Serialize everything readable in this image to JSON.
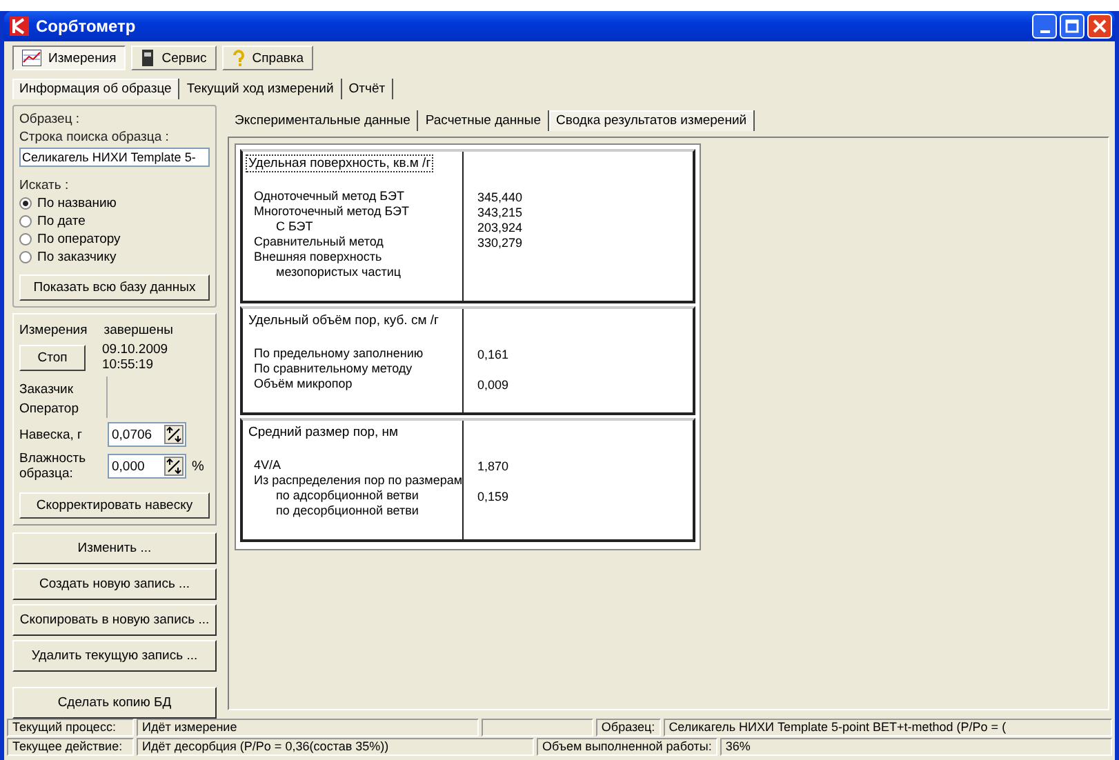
{
  "window": {
    "title": "Сорбтометр"
  },
  "menu": [
    {
      "label": "Измерения",
      "selected": true
    },
    {
      "label": "Сервис",
      "selected": false
    },
    {
      "label": "Справка",
      "selected": false
    }
  ],
  "tabs": [
    {
      "label": "Информация об образце",
      "selected": true
    },
    {
      "label": "Текущий ход измерений",
      "selected": false
    },
    {
      "label": "Отчёт",
      "selected": false
    }
  ],
  "sample": {
    "legend": "Образец :",
    "search_label": "Строка поиска образца :",
    "search_value": "Селикагель НИХИ Template 5-",
    "search_by_label": "Искать :",
    "radios": [
      {
        "label": "По названию",
        "selected": true
      },
      {
        "label": "По дате",
        "selected": false
      },
      {
        "label": "По оператору",
        "selected": false
      },
      {
        "label": "По заказчику",
        "selected": false
      }
    ],
    "show_all_button": "Показать всю базу данных"
  },
  "measurement": {
    "status_label": "Измерения",
    "status_value": "завершены",
    "stop_button": "Стоп",
    "date": "09.10.2009",
    "time": "10:55:19",
    "customer_label": "Заказчик",
    "operator_label": "Оператор",
    "weight_label": "Навеска, г",
    "weight_value": "0,0706",
    "moisture_label": "Влажность образца:",
    "moisture_value": "0,000",
    "moisture_unit": "%",
    "correct_button": "Скорректировать навеску"
  },
  "buttons": [
    "Изменить ...",
    "Создать новую запись ...",
    "Скопировать в новую запись ...",
    "Удалить текущую запись ...",
    "Сделать копию БД"
  ],
  "inner_tabs": [
    {
      "label": "Экспериментальные данные",
      "selected": false
    },
    {
      "label": "Расчетные данные",
      "selected": false
    },
    {
      "label": "Сводка результатов измерений",
      "selected": true
    }
  ],
  "sections": [
    {
      "title": "Удельная поверхность, кв.м /г",
      "focused": true,
      "rows": [
        {
          "label": "Одноточечный метод БЭТ",
          "value": "345,440"
        },
        {
          "label": "Многоточечный метод БЭТ",
          "value": "343,215",
          "children": [
            {
              "label": "С БЭТ",
              "value": "203,924"
            }
          ]
        },
        {
          "label": "Сравнительный метод",
          "value": "330,279"
        },
        {
          "label": "Внешняя поверхность",
          "children": [
            {
              "label": "мезопористых частиц"
            }
          ]
        }
      ]
    },
    {
      "title": "Удельный объём пор, куб. см /г",
      "focused": false,
      "rows": [
        {
          "label": "По предельному заполнению",
          "value": "0,161"
        },
        {
          "label": "По сравнительному методу"
        },
        {
          "label": "Объём микропор",
          "value": "0,009"
        }
      ]
    },
    {
      "title": "Средний размер пор, нм",
      "focused": false,
      "rows": [
        {
          "label": "4V/A",
          "value": "1,870"
        },
        {
          "label": "Из распределения пор по размерам",
          "children": [
            {
              "label": "по адсорбционной ветви",
              "value": "0,159"
            },
            {
              "label": "по десорбционной ветви"
            }
          ]
        }
      ]
    }
  ],
  "status_bar": [
    [
      {
        "text": "Текущий процесс:"
      },
      {
        "text": "Идёт измерение"
      },
      {
        "kind": "blank"
      },
      {
        "text": "Образец:"
      },
      {
        "text": "Селикагель НИХИ Template 5-point BET+t-method (P/Po = ("
      }
    ],
    [
      {
        "text": "Текущее действие:"
      },
      {
        "text": "Идёт десорбция (P/Po = 0,36(состав 35%))"
      },
      {
        "text": "Объем выполненной работы:"
      },
      {
        "text": "36%"
      }
    ]
  ]
}
